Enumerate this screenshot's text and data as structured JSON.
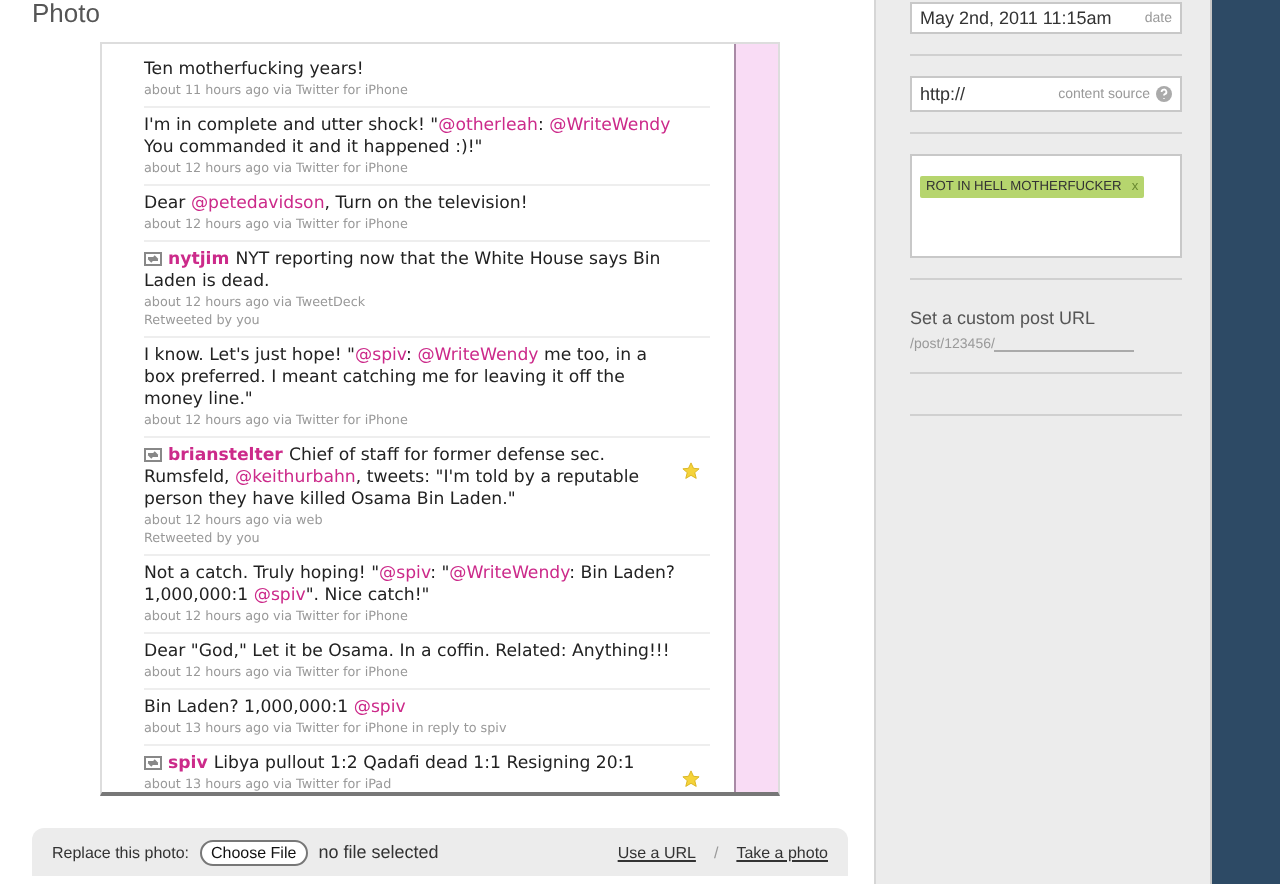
{
  "section_title": "Photo",
  "tweets": [
    {
      "kind": "tweet",
      "parts": [
        {
          "text": "Ten motherfucking years!",
          "kind": "plain"
        }
      ],
      "meta": "about 11 hours ago via Twitter for iPhone",
      "favorited": false
    },
    {
      "kind": "tweet",
      "parts": [
        {
          "text": "I'm in complete and utter shock! \"",
          "kind": "plain"
        },
        {
          "text": "@otherleah",
          "kind": "mention"
        },
        {
          "text": ": ",
          "kind": "plain"
        },
        {
          "text": "@WriteWendy",
          "kind": "mention"
        },
        {
          "text": " You commanded it and it happened :)!\"",
          "kind": "plain"
        }
      ],
      "meta": "about 12 hours ago via Twitter for iPhone",
      "favorited": false
    },
    {
      "kind": "tweet",
      "parts": [
        {
          "text": "Dear ",
          "kind": "plain"
        },
        {
          "text": "@petedavidson",
          "kind": "mention"
        },
        {
          "text": ", Turn on the television!",
          "kind": "plain"
        }
      ],
      "meta": "about 12 hours ago via Twitter for iPhone",
      "favorited": false
    },
    {
      "kind": "retweet",
      "user": "nytjim",
      "parts": [
        {
          "text": "NYT reporting now that the White House says Bin Laden is dead.",
          "kind": "plain"
        }
      ],
      "meta": "about 12 hours ago via TweetDeck",
      "retweeted_by": "Retweeted by you",
      "favorited": false
    },
    {
      "kind": "tweet",
      "parts": [
        {
          "text": "I know. Let's just hope! \"",
          "kind": "plain"
        },
        {
          "text": "@spiv",
          "kind": "mention"
        },
        {
          "text": ": ",
          "kind": "plain"
        },
        {
          "text": "@WriteWendy",
          "kind": "mention"
        },
        {
          "text": " me too, in a box preferred. I meant catching me for leaving it off the money line.\"",
          "kind": "plain"
        }
      ],
      "meta": "about 12 hours ago via Twitter for iPhone",
      "favorited": false
    },
    {
      "kind": "retweet",
      "user": "brianstelter",
      "parts": [
        {
          "text": "Chief of staff for former defense sec. Rumsfeld, ",
          "kind": "plain"
        },
        {
          "text": "@keithurbahn",
          "kind": "mention"
        },
        {
          "text": ", tweets: \"I'm told by a reputable person they have killed Osama Bin Laden.\"",
          "kind": "plain"
        }
      ],
      "meta": "about 12 hours ago via web",
      "retweeted_by": "Retweeted by you",
      "favorited": true
    },
    {
      "kind": "tweet",
      "parts": [
        {
          "text": "Not a catch. Truly hoping! \"",
          "kind": "plain"
        },
        {
          "text": "@spiv",
          "kind": "mention"
        },
        {
          "text": ": \"",
          "kind": "plain"
        },
        {
          "text": "@WriteWendy",
          "kind": "mention"
        },
        {
          "text": ": Bin Laden? 1,000,000:1 ",
          "kind": "plain"
        },
        {
          "text": "@spiv",
          "kind": "mention"
        },
        {
          "text": "\". Nice catch!\"",
          "kind": "plain"
        }
      ],
      "meta": "about 12 hours ago via Twitter for iPhone",
      "favorited": false
    },
    {
      "kind": "tweet",
      "parts": [
        {
          "text": "Dear \"God,\" Let it be Osama. In a coffin. Related: Anything!!!",
          "kind": "plain"
        }
      ],
      "meta": "about 12 hours ago via Twitter for iPhone",
      "favorited": false
    },
    {
      "kind": "tweet",
      "parts": [
        {
          "text": "Bin Laden? 1,000,000:1 ",
          "kind": "plain"
        },
        {
          "text": "@spiv",
          "kind": "mention"
        }
      ],
      "meta": "about 13 hours ago via Twitter for iPhone in reply to spiv",
      "favorited": false
    },
    {
      "kind": "retweet",
      "user": "spiv",
      "parts": [
        {
          "text": "Libya pullout 1:2 Qadafi dead 1:1 Resigning 20:1",
          "kind": "plain"
        }
      ],
      "meta": "about 13 hours ago via Twitter for iPad",
      "favorited": true
    }
  ],
  "replace_bar": {
    "label": "Replace this photo:",
    "button": "Choose File",
    "status": "no file selected",
    "links": [
      "Use a URL",
      "Take a photo"
    ],
    "separator": "/"
  },
  "sidebar": {
    "date_field": {
      "value": "May 2nd, 2011 11:15am",
      "hint": "date"
    },
    "source_field": {
      "value": "http://",
      "hint": "content source"
    },
    "tags": [
      {
        "label": "ROT IN HELL MOTHERFUCKER",
        "remove": "x"
      }
    ],
    "custom_url": {
      "label": "Set a custom post URL",
      "prefix": "/post/123456/"
    }
  }
}
